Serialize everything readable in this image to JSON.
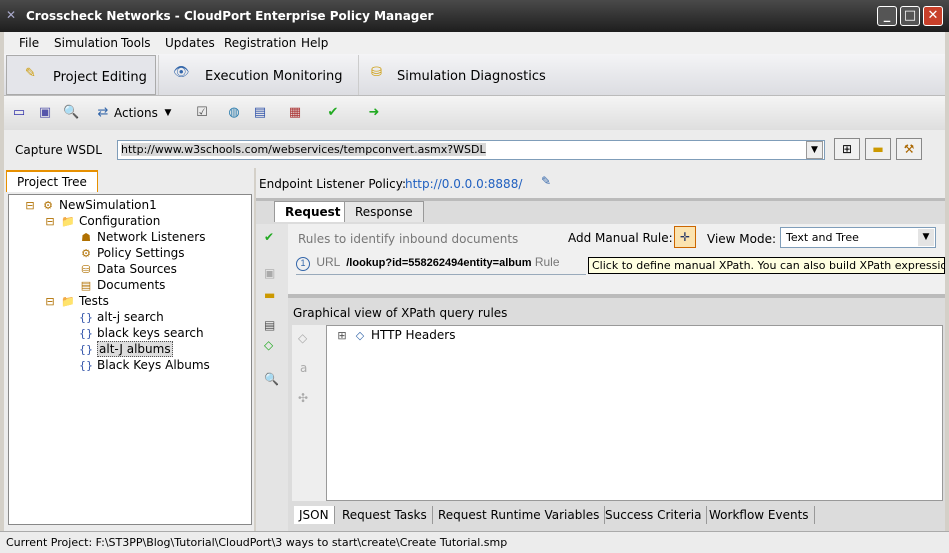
{
  "window": {
    "title": "Crosscheck Networks - CloudPort Enterprise Policy Manager"
  },
  "menu": [
    "File",
    "Simulation",
    "Tools",
    "Updates",
    "Registration",
    "Help"
  ],
  "modes": [
    {
      "label": "Project Editing",
      "active": true
    },
    {
      "label": "Execution Monitoring"
    },
    {
      "label": "Simulation Diagnostics"
    }
  ],
  "toolbar": {
    "actions_label": "Actions"
  },
  "wsdl": {
    "label": "Capture WSDL",
    "value": "http://www.w3schools.com/webservices/tempconvert.asmx?WSDL"
  },
  "left": {
    "tab": "Project Tree",
    "tree": [
      "NewSimulation1",
      "Configuration",
      "Network Listeners",
      "Policy Settings",
      "Data Sources",
      "Documents",
      "Tests",
      "alt-j search",
      "black keys search",
      "alt-J albums",
      "Black Keys Albums"
    ]
  },
  "right": {
    "endpoint_label": "Endpoint Listener Policy:",
    "endpoint_value": "http://0.0.0.0:8888/",
    "tabs": [
      "Request",
      "Response"
    ],
    "rules_label": "Rules to identify inbound documents",
    "add_rule_label": "Add Manual Rule:",
    "view_mode_label": "View Mode:",
    "view_mode_value": "Text and Tree",
    "rule": {
      "num": "1",
      "type": "URL",
      "value": "/lookup?id=558262494entity=album",
      "suffix": "Rule"
    },
    "tooltip": "Click to define manual XPath.  You can also build XPath expressions from Tree",
    "graph_label": "Graphical view of XPath query rules",
    "graph_node": "HTTP Headers",
    "bottom_tabs": [
      "JSON",
      "Request Tasks",
      "Request Runtime Variables",
      "Success Criteria",
      "Workflow Events"
    ]
  },
  "status": "Current Project: F:\\ST3PP\\Blog\\Tutorial\\CloudPort\\3 ways to start\\create\\Create Tutorial.smp"
}
